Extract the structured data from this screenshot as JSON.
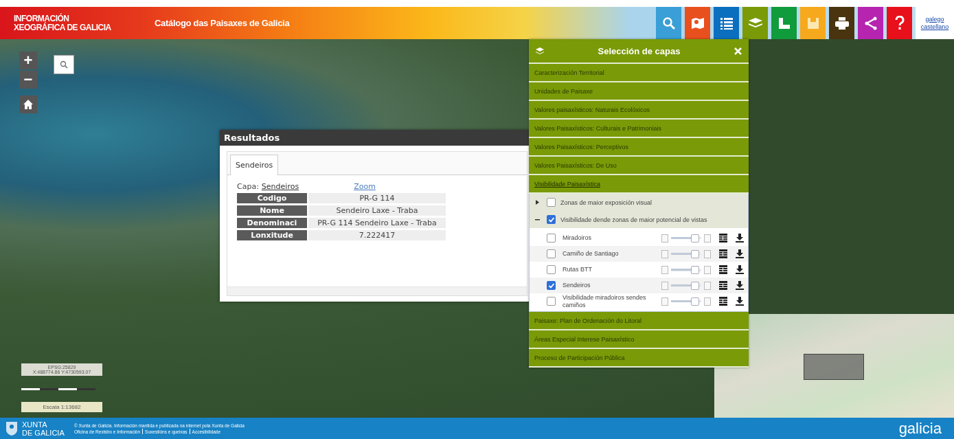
{
  "header": {
    "logo_lines": [
      "INFORMACIÓN",
      "XEOGRÁFICA DE GALICIA"
    ],
    "subtitle": "Catálogo das Paisaxes de Galicia",
    "tools": [
      {
        "kind": "search",
        "color": "#3a9fd6"
      },
      {
        "kind": "map",
        "color": "#e8501e"
      },
      {
        "kind": "list",
        "color": "#0b6fc0"
      },
      {
        "kind": "layers",
        "color": "#7a9a07"
      },
      {
        "kind": "measure",
        "color": "#109b3c"
      },
      {
        "kind": "save",
        "color": "#f6a91c"
      },
      {
        "kind": "print",
        "color": "#4a3410"
      },
      {
        "kind": "share",
        "color": "#b624b0"
      },
      {
        "kind": "help",
        "color": "#e8101a"
      }
    ],
    "language_links": [
      "galego",
      "castellano"
    ]
  },
  "map_controls": {
    "zoom_in": "+",
    "zoom_out": "−"
  },
  "results": {
    "title": "Resultados",
    "tabs": [
      {
        "label": "Sendeiros",
        "selected": true
      }
    ],
    "layer_label": "Capa:",
    "layer_link": "Sendeiros",
    "zoom_link": "Zoom",
    "rows": [
      {
        "field": "Codigo",
        "value": "PR-G 114"
      },
      {
        "field": "Nome",
        "value": "Sendeiro Laxe - Traba"
      },
      {
        "field": "Denominaci",
        "value": "PR-G 114 Sendeiro Laxe - Traba"
      },
      {
        "field": "Lonxitude",
        "value": "7.222417"
      }
    ]
  },
  "layers": {
    "title": "Selección de capas",
    "groups": [
      {
        "label": "Caracterización Territorial",
        "expanded": false
      },
      {
        "label": "Unidades de Paisaxe",
        "expanded": false
      },
      {
        "label": "Valores paisaxísticos: Naturais Ecolóxicos",
        "expanded": false
      },
      {
        "label": "Valores Paisaxísticos: Culturais e Patrimoniais",
        "expanded": false
      },
      {
        "label": "Valores Paisaxísticos: Perceptivos",
        "expanded": false
      },
      {
        "label": "Valores Paisaxísticos: De Uso",
        "expanded": false
      },
      {
        "label": "Visibilidade Paisaxística",
        "expanded": true,
        "children": [
          {
            "label": "Zonas de maior exposición visual",
            "checked": false,
            "expanded": false
          },
          {
            "label": "Visibilidade dende zonas de maior potencial de vistas",
            "checked": true,
            "expanded": true,
            "children": [
              {
                "label": "Miradoiros",
                "checked": false,
                "level": 0.8
              },
              {
                "label": "Camiño de Santiago",
                "checked": false,
                "level": 0.8
              },
              {
                "label": "Rutas BTT",
                "checked": false,
                "level": 0.8
              },
              {
                "label": "Sendeiros",
                "checked": true,
                "level": 0.8
              },
              {
                "label": "Visibilidade miradoiros sendes camiños",
                "checked": false,
                "level": 0.8
              }
            ]
          }
        ]
      },
      {
        "label": "Paisaxe: Plan de Ordenación do Litoral",
        "expanded": false
      },
      {
        "label": "Áreas Especial Interese Paisaxístico",
        "expanded": false
      },
      {
        "label": "Proceso de Participación Pública",
        "expanded": false
      }
    ]
  },
  "coordinates": {
    "epsg": "EPSG:25829",
    "xy": "X:488774.86 Y:4730593.07",
    "scale": "Escala 1:13682"
  },
  "footer": {
    "logo_lines": [
      "XUNTA",
      "DE GALICIA"
    ],
    "notice": "© Xunta de Galicia. Información mantida e publicada na internet pola Xunta de Galicia",
    "links": [
      "Oficina de Rexistro e Información",
      "Suxestións e queixas",
      "Accesibilidade"
    ],
    "brand": "galicia"
  }
}
